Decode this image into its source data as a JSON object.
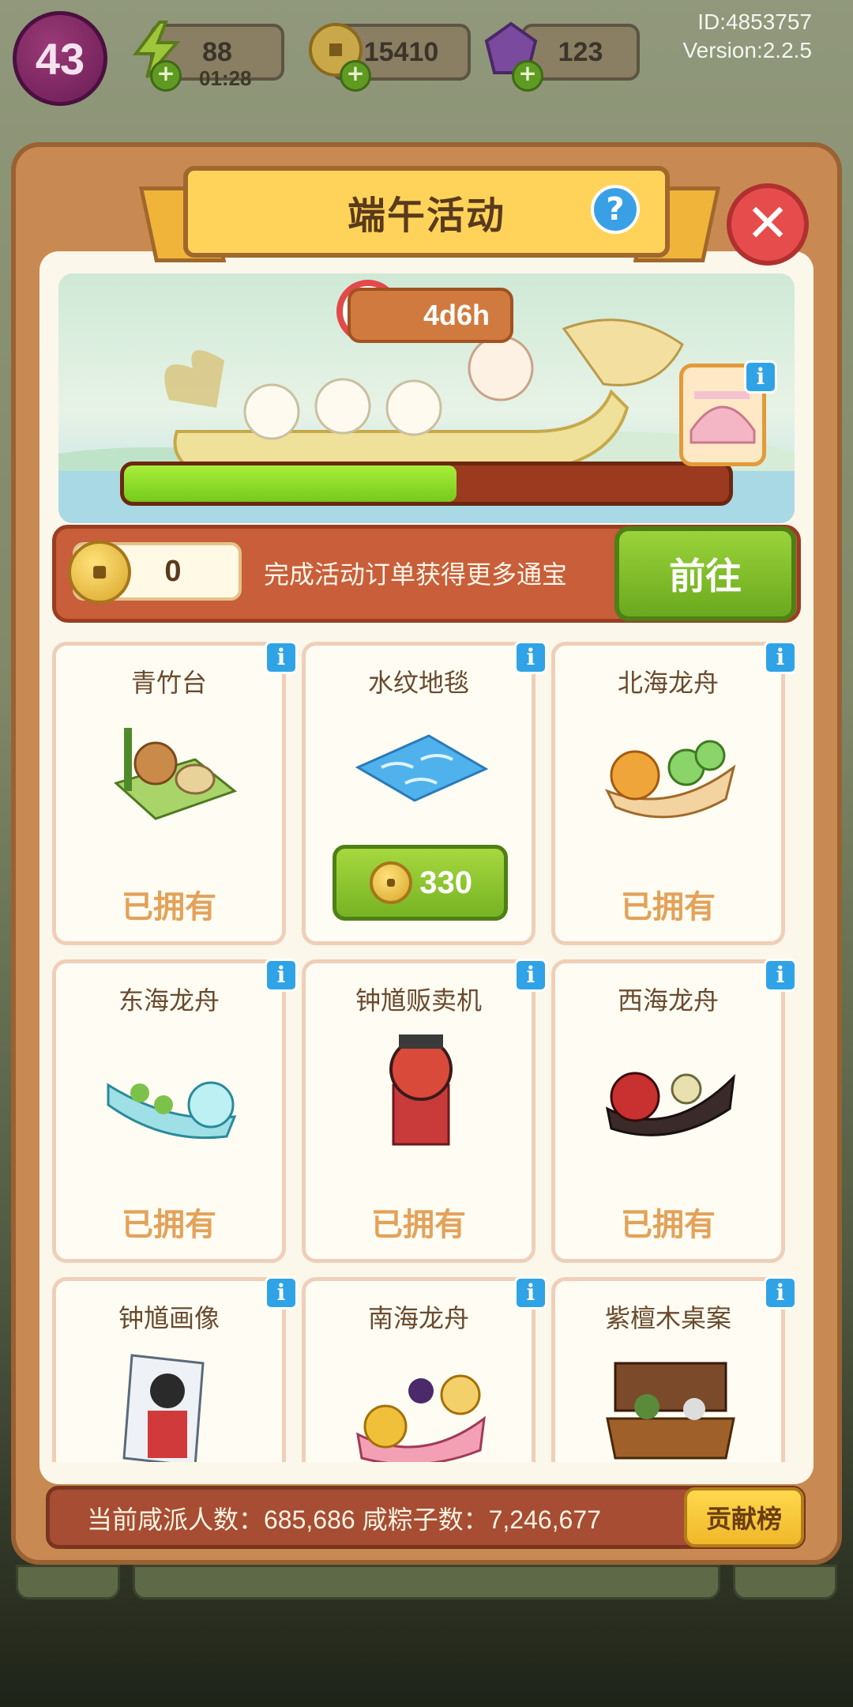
{
  "hud": {
    "level": "43",
    "energy": "88",
    "energy_timer": "01:28",
    "coins": "15410",
    "gems": "123",
    "id_text": "ID:4853757",
    "version_text": "Version:2.2.5"
  },
  "panel": {
    "title": "端午活动",
    "help": "?",
    "close": "✕",
    "timer": "4d6h",
    "progress": 0.55
  },
  "order": {
    "coin_count": "0",
    "text": "完成活动订单获得更多通宝",
    "go": "前往"
  },
  "items": [
    {
      "name": "青竹台",
      "status": "已拥有"
    },
    {
      "name": "水纹地毯",
      "price": "330"
    },
    {
      "name": "北海龙舟",
      "status": "已拥有"
    },
    {
      "name": "东海龙舟",
      "status": "已拥有"
    },
    {
      "name": "钟馗贩卖机",
      "status": "已拥有"
    },
    {
      "name": "西海龙舟",
      "status": "已拥有"
    },
    {
      "name": "钟馗画像"
    },
    {
      "name": "南海龙舟"
    },
    {
      "name": "紫檀木桌案"
    }
  ],
  "footer": {
    "stats": "当前咸派人数：685,686   咸粽子数：7,246,677",
    "rank": "贡献榜"
  },
  "colors": {
    "panel": "#c88a52",
    "accent_green": "#77b324",
    "info_blue": "#2fa3e6",
    "owned_text": "#e3a25a"
  }
}
